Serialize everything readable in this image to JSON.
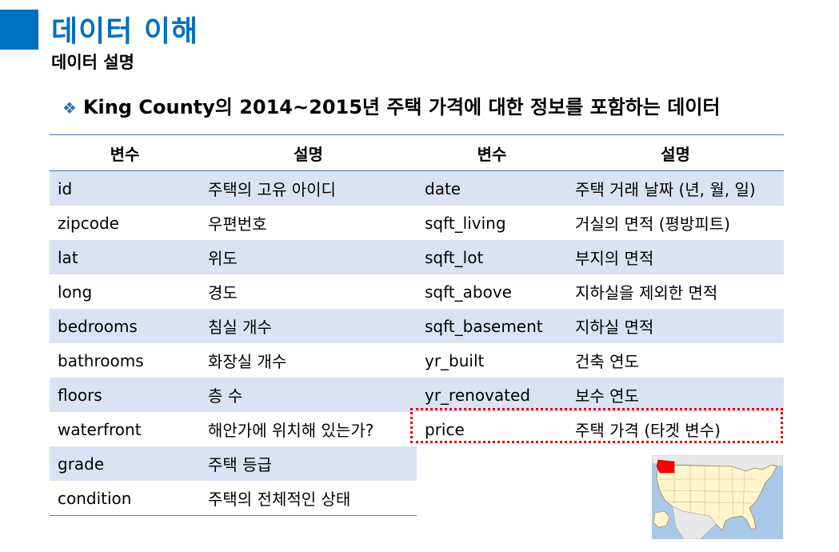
{
  "header": {
    "title": "데이터 이해",
    "subtitle": "데이터 설명",
    "headline": "King County의 2014~2015년 주택 가격에 대한 정보를 포함하는 데이터",
    "accent_color": "#0070c0"
  },
  "table": {
    "headers": [
      "변수",
      "설명",
      "변수",
      "설명"
    ],
    "rows": [
      {
        "var1": "id",
        "desc1": "주택의 고유 아이디",
        "var2": "date",
        "desc2": "주택 거래 날짜 (년, 월, 일)"
      },
      {
        "var1": "zipcode",
        "desc1": "우편번호",
        "var2": "sqft_living",
        "desc2": "거실의 면적 (평방피트)"
      },
      {
        "var1": "lat",
        "desc1": "위도",
        "var2": "sqft_lot",
        "desc2": "부지의 면적"
      },
      {
        "var1": "long",
        "desc1": "경도",
        "var2": "sqft_above",
        "desc2": "지하실을 제외한 면적"
      },
      {
        "var1": "bedrooms",
        "desc1": "침실 개수",
        "var2": "sqft_basement",
        "desc2": "지하실 면적"
      },
      {
        "var1": "bathrooms",
        "desc1": "화장실 개수",
        "var2": "yr_built",
        "desc2": "건축 연도"
      },
      {
        "var1": "floors",
        "desc1": "층 수",
        "var2": "yr_renovated",
        "desc2": "보수 연도"
      },
      {
        "var1": "waterfront",
        "desc1": "해안가에 위치해 있는가?",
        "var2": "price",
        "desc2": "주택 가격 (타겟 변수)"
      },
      {
        "var1": "grade",
        "desc1": "주택 등급"
      },
      {
        "var1": "condition",
        "desc1": "주택의 전체적인 상태"
      }
    ],
    "highlight_color": "#e00000",
    "stripe_color": "#dae3f3",
    "rule_color": "#4472c4"
  },
  "map": {
    "icon": "us-map-icon",
    "land_color": "#fff5cc",
    "water_color": "#a9c7e8",
    "highlight_color": "#ff0000"
  }
}
